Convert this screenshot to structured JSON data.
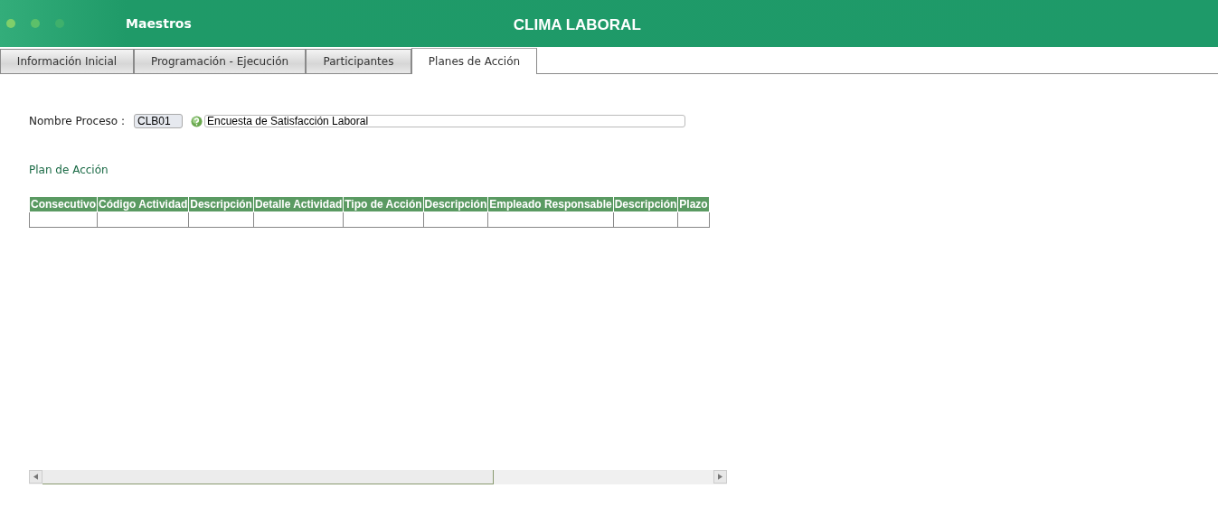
{
  "header": {
    "section": "Maestros",
    "title": "CLIMA LABORAL"
  },
  "tabs": [
    {
      "label": "Información Inicial",
      "selected": false
    },
    {
      "label": "Programación - Ejecución",
      "selected": false
    },
    {
      "label": "Participantes",
      "selected": false
    },
    {
      "label": "Planes de Acción",
      "selected": true
    }
  ],
  "process": {
    "label": "Nombre Proceso :",
    "code": "CLB01",
    "name": "Encuesta de Satisfacción Laboral"
  },
  "plan": {
    "title": "Plan de Acción",
    "columns": [
      "Consecutivo",
      "Código Actividad",
      "Descripción",
      "Detalle Actividad",
      "Tipo de Acción",
      "Descripción",
      "Empleado Responsable",
      "Descripción",
      "Plazo"
    ]
  }
}
